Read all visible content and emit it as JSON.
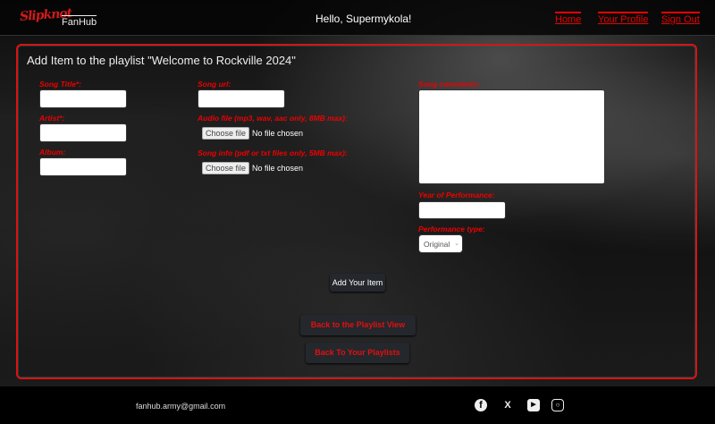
{
  "header": {
    "logo": "Slipknot",
    "logo_sub": "FanHub",
    "greeting": "Hello, Supermykola!",
    "nav": [
      "Home",
      "Your Profile",
      "Sign Out"
    ]
  },
  "form": {
    "title": "Add Item to the playlist \"Welcome to Rockville 2024\"",
    "song_title_label": "Song Title*:",
    "artist_label": "Artist*:",
    "album_label": "Album:",
    "song_url_label": "Song url:",
    "audio_label": "Audio file (mp3, wav, aac only, 8MB max):",
    "info_label": "Song info (pdf or txt files only, 5MB max):",
    "choose_file": "Choose file",
    "no_file": "No file chosen",
    "comments_label": "Song comments:",
    "year_label": "Year of Performance:",
    "type_label": "Performance type:",
    "type_value": "Original",
    "submit": "Add Your Item"
  },
  "actions": {
    "back_view": "Back to the Playlist View",
    "back_playlists": "Back To Your Playlists"
  },
  "footer": {
    "email": "fanhub.army@gmail.com",
    "icons": [
      "facebook-icon",
      "x-icon",
      "youtube-icon",
      "instagram-icon"
    ]
  },
  "colors": {
    "accent": "#e01010"
  }
}
